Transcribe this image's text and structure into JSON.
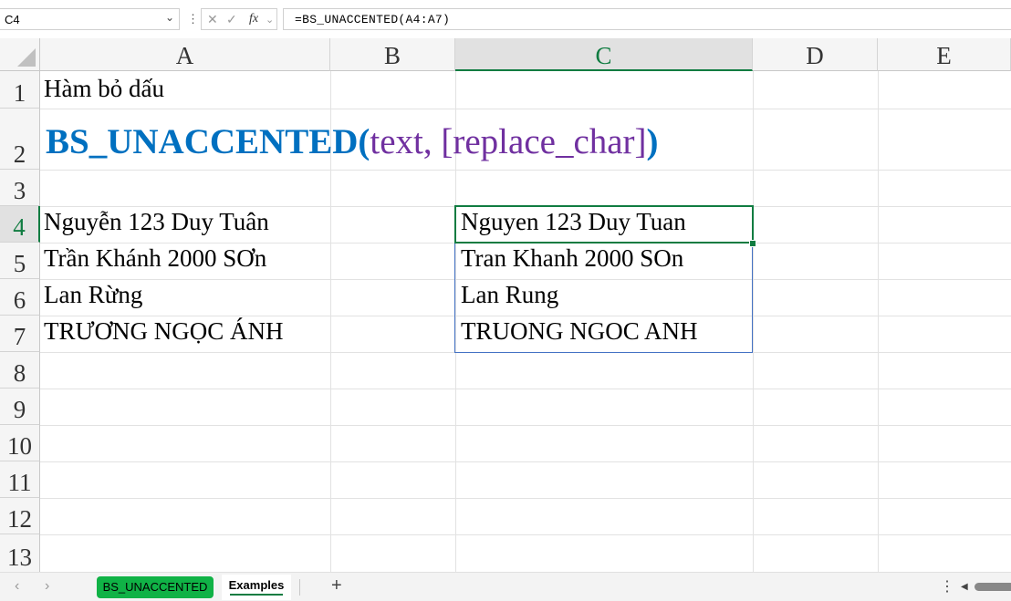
{
  "formula_bar": {
    "name_box": "C4",
    "formula": "=BS_UNACCENTED(A4:A7)",
    "fx_label": "fx"
  },
  "columns": [
    "A",
    "B",
    "C",
    "D",
    "E"
  ],
  "rows": [
    "1",
    "2",
    "3",
    "4",
    "5",
    "6",
    "7",
    "8",
    "9",
    "10",
    "11",
    "12",
    "13"
  ],
  "selected_cell": "C4",
  "cells": {
    "A1": "Hàm bỏ dấu",
    "A2_func": "BS_UNACCENTED",
    "A2_open": "(",
    "A2_args": "text, [replace_char]",
    "A2_close": ")",
    "A4": "Nguyễn 123 Duy Tuân",
    "A5": "Trần Khánh 2000 SƠn",
    "A6": "Lan Rừng",
    "A7": "TRƯƠNG NGỌC ÁNH",
    "C4": "Nguyen 123 Duy Tuan",
    "C5": "Tran Khanh 2000 SOn",
    "C6": "Lan Rung",
    "C7": "TRUONG NGOC ANH"
  },
  "sheet_tabs": [
    {
      "label": "BS_UNACCENTED",
      "color": "#10b246",
      "active": false
    },
    {
      "label": "Examples",
      "active": true
    }
  ],
  "colors": {
    "title_blue": "#0070c0",
    "args_purple": "#7030a0",
    "selection_green": "#107c41"
  }
}
